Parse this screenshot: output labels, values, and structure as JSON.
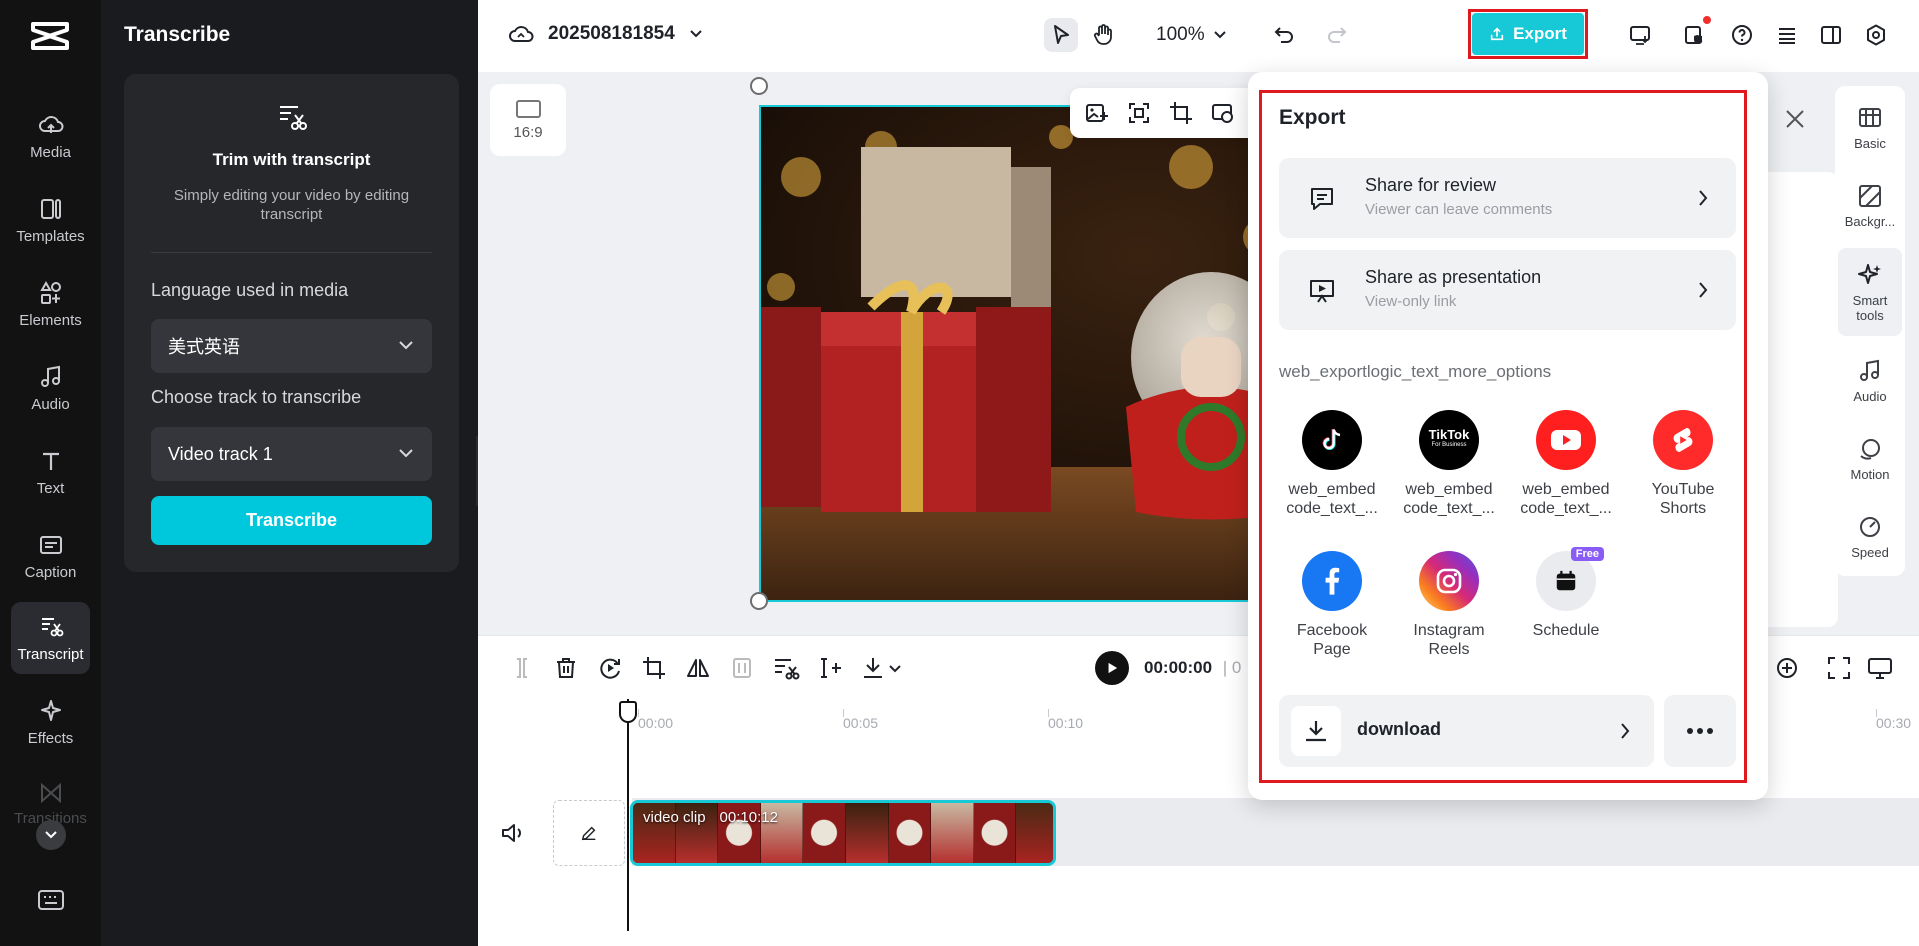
{
  "left_rail": {
    "items": [
      {
        "label": "Media",
        "icon": "cloud-upload-icon"
      },
      {
        "label": "Templates",
        "icon": "templates-icon"
      },
      {
        "label": "Elements",
        "icon": "elements-icon"
      },
      {
        "label": "Audio",
        "icon": "music-note-icon"
      },
      {
        "label": "Text",
        "icon": "text-icon"
      },
      {
        "label": "Caption",
        "icon": "caption-icon"
      },
      {
        "label": "Transcript",
        "icon": "transcript-icon"
      },
      {
        "label": "Effects",
        "icon": "sparkle-icon"
      }
    ],
    "active": "Transcript",
    "faded_item": "Transitions"
  },
  "transcribe_panel": {
    "title": "Transcribe",
    "card_title": "Trim with transcript",
    "card_subtitle": "Simply editing your video by editing transcript",
    "language_label": "Language used in media",
    "language_value": "美式英语",
    "track_label": "Choose track to transcribe",
    "track_value": "Video track 1",
    "transcribe_button": "Transcribe"
  },
  "topbar": {
    "project_name": "202508181854",
    "zoom": "100%",
    "export_label": "Export"
  },
  "canvas": {
    "aspect_ratio": "16:9"
  },
  "right_rail": {
    "items": [
      {
        "label": "Basic",
        "icon": "basic-icon"
      },
      {
        "label": "Backgr...",
        "icon": "background-icon"
      },
      {
        "label": "Smart tools",
        "icon": "smart-tools-icon"
      },
      {
        "label": "Audio",
        "icon": "audio-icon"
      },
      {
        "label": "Motion",
        "icon": "motion-icon"
      },
      {
        "label": "Speed",
        "icon": "speed-icon"
      }
    ],
    "active": "Smart tools"
  },
  "timeline": {
    "timecode": "00:00:00",
    "timecode_sep": "| 0",
    "ruler": [
      "00:00",
      "00:05",
      "00:10",
      "00:30"
    ],
    "clip_label": "video clip",
    "clip_duration": "00:10:12"
  },
  "export_popover": {
    "title": "Export",
    "share_review_title": "Share for review",
    "share_review_sub": "Viewer can leave comments",
    "share_pres_title": "Share as presentation",
    "share_pres_sub": "View-only link",
    "more_options": "web_exportlogic_text_more_options",
    "platforms": [
      {
        "label1": "web_embed",
        "label2": "code_text_...",
        "icon": "tiktok-icon",
        "color": "#000000"
      },
      {
        "label1": "web_embed",
        "label2": "code_text_...",
        "icon": "tiktok-business-icon",
        "color": "#000000"
      },
      {
        "label1": "web_embed",
        "label2": "code_text_...",
        "icon": "youtube-icon",
        "color": "#ff1f1f"
      },
      {
        "label1": "YouTube",
        "label2": "Shorts",
        "icon": "youtube-shorts-icon",
        "color": "#ff2a2a"
      },
      {
        "label1": "Facebook",
        "label2": "Page",
        "icon": "facebook-icon",
        "color": "#1877f2"
      },
      {
        "label1": "Instagram",
        "label2": "Reels",
        "icon": "instagram-icon",
        "color": "#d62976"
      },
      {
        "label1": "Schedule",
        "label2": "",
        "icon": "calendar-icon",
        "color": "#e9ebee"
      }
    ],
    "tiktok_business_text": "TikTok",
    "tiktok_business_sub": "For Business",
    "free_badge": "Free",
    "download_label": "download"
  },
  "colors": {
    "accent": "#17c9d6",
    "highlight": "#e0191f",
    "dark_panel": "#1a1b1e"
  }
}
